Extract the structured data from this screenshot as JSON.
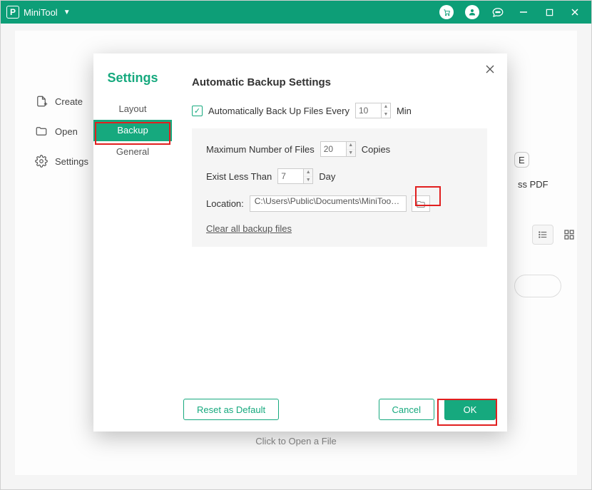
{
  "titlebar": {
    "app_name": "MiniTool"
  },
  "sidebar_main": {
    "create": "Create",
    "open": "Open",
    "settings": "Settings"
  },
  "background": {
    "snippet_top": "E",
    "snippet_bottom": "ss PDF"
  },
  "footer": {
    "open_hint": "Click to Open a File"
  },
  "dialog": {
    "heading": "Settings",
    "tabs": {
      "layout": "Layout",
      "backup": "Backup",
      "general": "General"
    },
    "title": "Automatic Backup Settings",
    "auto_backup_label": "Automatically Back Up Files Every",
    "auto_backup_value": "10",
    "auto_backup_unit": "Min",
    "max_files_label": "Maximum Number of Files",
    "max_files_value": "20",
    "max_files_unit": "Copies",
    "less_than_label": "Exist Less Than",
    "less_than_value": "7",
    "less_than_unit": "Day",
    "location_label": "Location:",
    "location_value": "C:\\Users\\Public\\Documents\\MiniToolPDFD",
    "clear_link": "Clear all backup files",
    "reset_label": "Reset as Default",
    "cancel_label": "Cancel",
    "ok_label": "OK"
  }
}
